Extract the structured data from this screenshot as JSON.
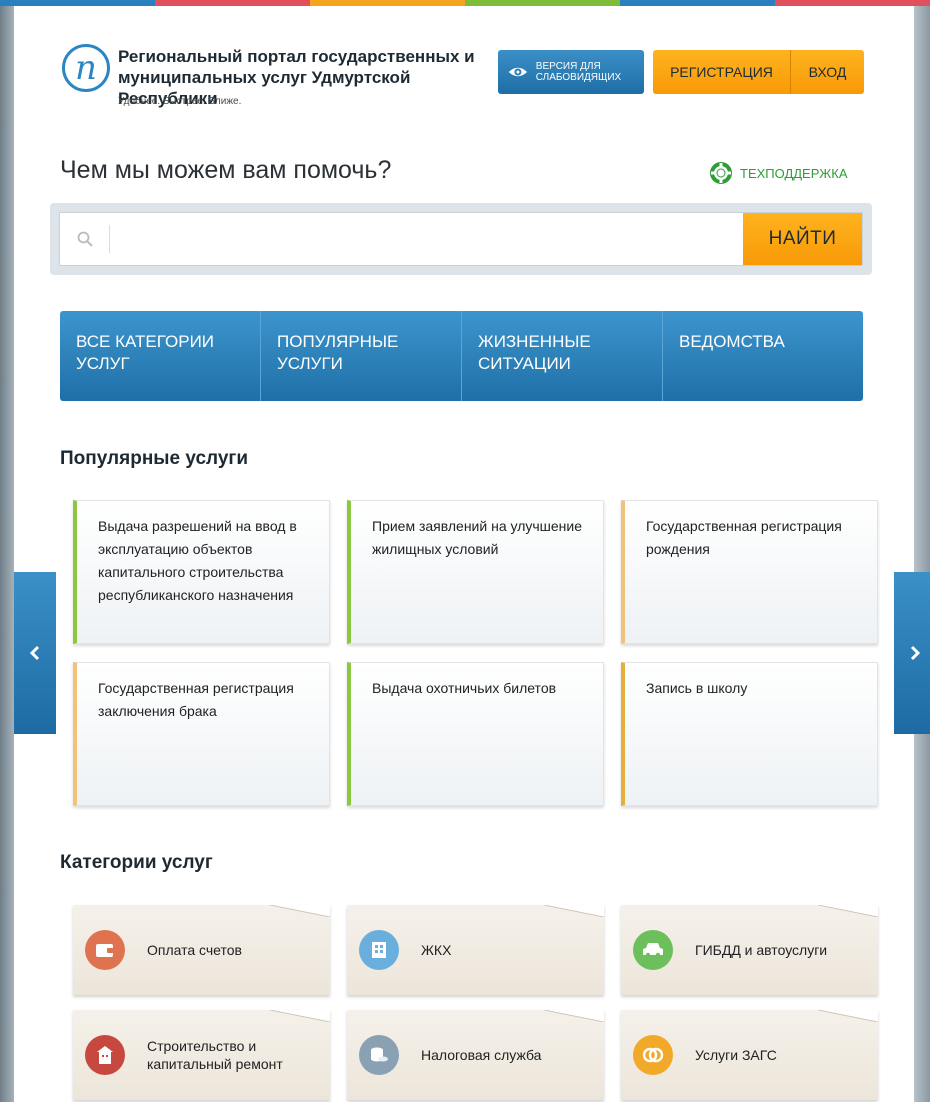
{
  "header": {
    "logo_letter": "n",
    "logo_title": "Региональный портал государственных и муниципальных услуг Удмуртской Республики",
    "tagline": "Удобнее. Быстрее. Ближе.",
    "low_vision_label": "ВЕРСИЯ ДЛЯ СЛАБОВИДЯЩИХ",
    "register_label": "РЕГИСТРАЦИЯ",
    "login_label": "ВХОД"
  },
  "help": {
    "title": "Чем мы можем вам помочь?",
    "support_label": "ТЕХПОДДЕРЖКА"
  },
  "search": {
    "placeholder": "",
    "value": "",
    "button_label": "НАЙТИ"
  },
  "nav": {
    "tabs": [
      {
        "label": "ВСЕ КАТЕГОРИИ УСЛУГ"
      },
      {
        "label": "ПОПУЛЯРНЫЕ УСЛУГИ"
      },
      {
        "label": "ЖИЗНЕННЫЕ СИТУАЦИИ"
      },
      {
        "label": "ВЕДОМСТВА"
      }
    ]
  },
  "popular": {
    "title": "Популярные услуги",
    "cards": [
      {
        "label": "Выдача разрешений на ввод в эксплуатацию объектов капитального строительства республиканского назначения",
        "accent": "#8dc63f"
      },
      {
        "label": "Прием заявлений на улучшение жилищных условий",
        "accent": "#8dc63f"
      },
      {
        "label": "Государственная регистрация рождения",
        "accent": "#f2c27a"
      },
      {
        "label": "Государственная регистрация заключения брака",
        "accent": "#f2c27a"
      },
      {
        "label": "Выдача охотничьих билетов",
        "accent": "#8dc63f"
      },
      {
        "label": "Запись в школу",
        "accent": "#e3b03d"
      }
    ]
  },
  "categories": {
    "title": "Категории услуг",
    "items": [
      {
        "label": "Оплата счетов",
        "icon": "wallet-icon",
        "color": "#e0734f"
      },
      {
        "label": "ЖКХ",
        "icon": "building-icon",
        "color": "#6aaede"
      },
      {
        "label": "ГИБДД и автоуслуги",
        "icon": "car-icon",
        "color": "#6cbf5a"
      },
      {
        "label": "Строительство и капитальный ремонт",
        "icon": "construction-icon",
        "color": "#c7483e"
      },
      {
        "label": "Налоговая служба",
        "icon": "coins-icon",
        "color": "#8aa0b3"
      },
      {
        "label": "Услуги ЗАГС",
        "icon": "rings-icon",
        "color": "#f2a929"
      }
    ]
  },
  "colors": {
    "accent_blue": "#2578b3",
    "accent_orange": "#f9a40f",
    "support_green": "#2e9d35"
  }
}
